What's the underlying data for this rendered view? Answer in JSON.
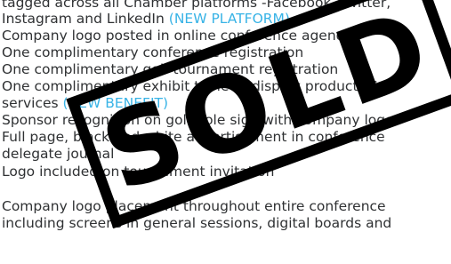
{
  "colors": {
    "text": "#2f3133",
    "accent": "#38b3e6",
    "stamp": "#000000"
  },
  "lines": [
    {
      "text": "tagged across all Chamber platforms -Facebook, Twitter,"
    },
    {
      "text": "Instagram and LinkedIn ",
      "accent": "(NEW PLATFORM)"
    },
    {
      "text": "Company logo posted in online conference agenda"
    },
    {
      "text": "One complimentary conference registration"
    },
    {
      "text": "One complimentary golf tournament registration"
    },
    {
      "text": "One complimentary exhibit table to display products &"
    },
    {
      "text": "services ",
      "accent": "(NEW BENEFIT)"
    },
    {
      "text": "Sponsor recognition on golf hole sign with company logo"
    },
    {
      "text": "Full page, black and white advertisement in conference"
    },
    {
      "text": "delegate journal"
    },
    {
      "text": "Logo included on tournament invitation"
    },
    {
      "text": "Company logo placement throughout entire conference"
    },
    {
      "text": "including screens in general sessions, digital boards and"
    }
  ],
  "stamp": {
    "text": "SOLD"
  }
}
